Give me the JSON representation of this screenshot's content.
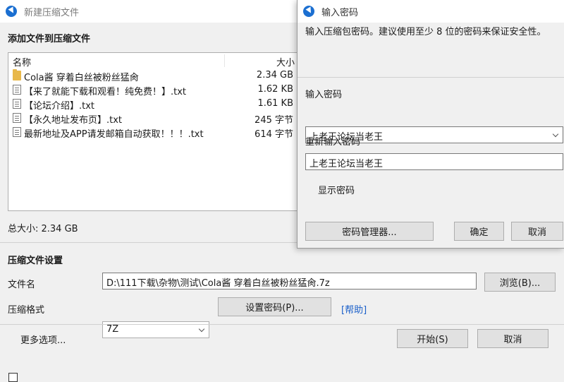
{
  "main": {
    "title": "新建压缩文件",
    "add_section_title": "添加文件到压缩文件",
    "columns": {
      "name": "名称",
      "size": "大小"
    },
    "files": [
      {
        "name": "Cola酱 穿着白丝被粉丝猛肏",
        "size": "2.34 GB",
        "type": "folder-icon"
      },
      {
        "name": "【来了就能下载和观看！纯免费！】.txt",
        "size": "1.62 KB",
        "type": "text-file-icon"
      },
      {
        "name": "【论坛介绍】.txt",
        "size": "1.61 KB",
        "type": "text-file-icon"
      },
      {
        "name": "【永久地址发布页】.txt",
        "size": "245 字节",
        "type": "text-file-icon"
      },
      {
        "name": "最新地址及APP请发邮箱自动获取！！！.txt",
        "size": "614 字节",
        "type": "text-file-icon"
      }
    ],
    "total_size": "总大小: 2.34 GB",
    "settings_title": "压缩文件设置",
    "filename_label": "文件名",
    "filename_value": "D:\\111下载\\杂物\\测试\\Cola酱 穿着白丝被粉丝猛肏.7z",
    "browse_label": "浏览(B)...",
    "format_label": "压缩格式",
    "format_value": "7Z",
    "set_password_label": "设置密码(P)...",
    "help_label": "[帮助]",
    "more_options_label": "更多选项...",
    "start_label": "开始(S)",
    "cancel_label": "取消"
  },
  "dialog": {
    "title": "输入密码",
    "description": "输入压缩包密码。建议使用至少 8 位的密码来保证安全性。",
    "password_label": "输入密码",
    "password_value": "上老王论坛当老王",
    "reenter_label": "重新输入密码",
    "reenter_value": "上老王论坛当老王",
    "show_password_label": "显示密码",
    "show_password_checked": true,
    "manager_label": "密码管理器...",
    "ok_label": "确定",
    "cancel_label": "取消"
  },
  "colors": {
    "accent": "#1b6fd1",
    "link": "#1a5fc9",
    "folder": "#e8b84a"
  }
}
